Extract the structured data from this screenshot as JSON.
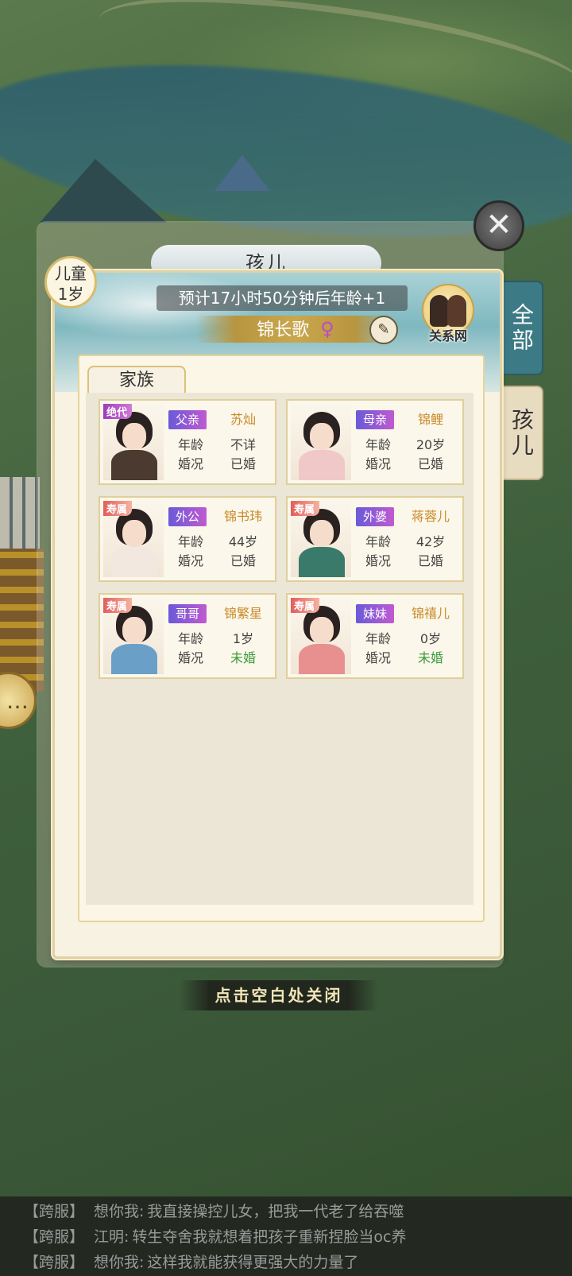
{
  "window": {
    "title": "孩儿",
    "close_hint": "点击空白处关闭",
    "close_icon": "close-icon"
  },
  "side_tabs": [
    {
      "label": "全部",
      "active": true
    },
    {
      "label": "孩儿",
      "active": false
    }
  ],
  "child": {
    "stage": "儿童",
    "age": "1岁",
    "timer_text": "预计17小时50分钟后年龄+1",
    "name": "锦长歌",
    "gender_icon": "♀",
    "relation_net_label": "关系网"
  },
  "family": {
    "tab_label": "家族",
    "age_label": "年龄",
    "marriage_label": "婚况",
    "members": [
      {
        "role": "父亲",
        "name": "苏灿",
        "age": "不详",
        "marriage": "已婚",
        "rarity": "绝代",
        "rarity_color": "purple",
        "robe": "#4a3a30"
      },
      {
        "role": "母亲",
        "name": "锦鲤",
        "age": "20岁",
        "marriage": "已婚",
        "rarity": "",
        "rarity_color": "",
        "robe": "#f0c8c8"
      },
      {
        "role": "外公",
        "name": "锦书玮",
        "age": "44岁",
        "marriage": "已婚",
        "rarity": "寿属",
        "rarity_color": "red",
        "robe": "#f2e8e0"
      },
      {
        "role": "外婆",
        "name": "蒋蓉儿",
        "age": "42岁",
        "marriage": "已婚",
        "rarity": "寿属",
        "rarity_color": "red",
        "robe": "#3a7a6a"
      },
      {
        "role": "哥哥",
        "name": "锦繁星",
        "age": "1岁",
        "marriage": "未婚",
        "rarity": "寿属",
        "rarity_color": "red",
        "robe": "#6aa0c8"
      },
      {
        "role": "妹妹",
        "name": "锦禧儿",
        "age": "0岁",
        "marriage": "未婚",
        "rarity": "寿属",
        "rarity_color": "red",
        "robe": "#e89090"
      }
    ]
  },
  "chat": [
    {
      "channel": "【跨服】",
      "speaker": "想你我:",
      "text": "我直接操控儿女，把我一代老了给吞噬"
    },
    {
      "channel": "【跨服】",
      "speaker": "江明:",
      "text": "转生夺舍我就想着把孩子重新捏脸当oc养"
    },
    {
      "channel": "【跨服】",
      "speaker": "想你我:",
      "text": "这样我就能获得更强大的力量了"
    }
  ],
  "colors": {
    "accent_gold": "#c9a74e",
    "tab_active": "#3c7a86",
    "married_text": "#444444",
    "unmarried_text": "#3a9a3a"
  }
}
